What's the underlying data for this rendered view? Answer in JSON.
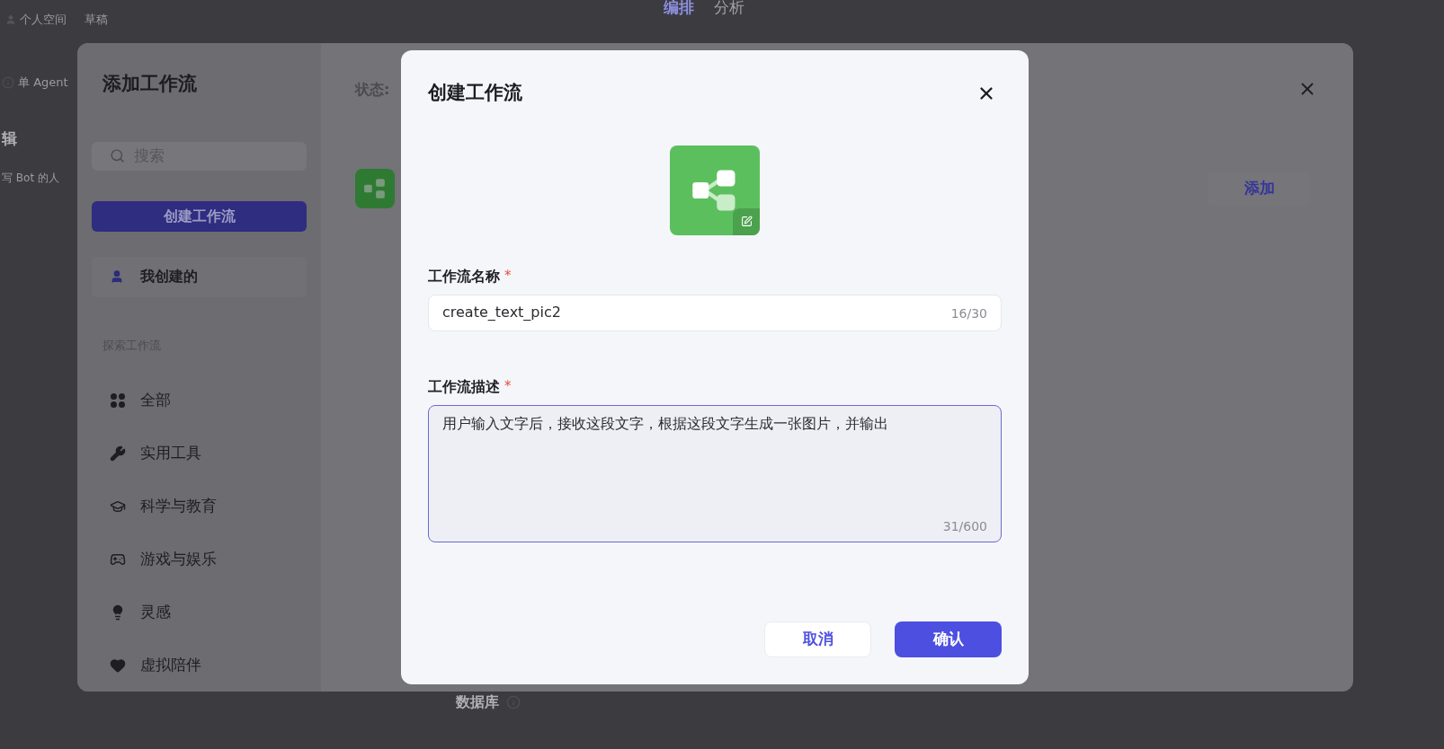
{
  "background_page": {
    "breadcrumbs": [
      {
        "text": "个人空间"
      },
      {
        "text": "草稿"
      }
    ],
    "tabs": [
      {
        "label": "编排",
        "selected": true
      },
      {
        "label": "分析",
        "selected": false
      }
    ],
    "mode": "单 Agent",
    "section_title": "辑",
    "section_hint": "写 Bot 的人",
    "bottom_item": "数据库"
  },
  "add_dialog": {
    "title": "添加工作流",
    "search_placeholder": "搜索",
    "create_button": "创建工作流",
    "my_item": {
      "label": "我创建的",
      "selected": true
    },
    "explore_header": "探索工作流",
    "categories": [
      {
        "kind": "all",
        "label": "全部"
      },
      {
        "kind": "tools",
        "label": "实用工具"
      },
      {
        "kind": "education",
        "label": "科学与教育"
      },
      {
        "kind": "games",
        "label": "游戏与娱乐"
      },
      {
        "kind": "inspiration",
        "label": "灵感"
      },
      {
        "kind": "companion",
        "label": "虚拟陪伴"
      }
    ],
    "status_label": "状态:",
    "add_button": "添加"
  },
  "create_dialog": {
    "title": "创建工作流",
    "name_field": {
      "label": "工作流名称",
      "required_mark": "*",
      "value": "create_text_pic2",
      "counter": "16/30",
      "focused": false
    },
    "description_field": {
      "label": "工作流描述",
      "required_mark": "*",
      "value": "用户输入文字后，接收这段文字，根据这段文字生成一张图片，并输出",
      "counter": "31/600",
      "focused": true
    },
    "buttons": [
      {
        "kind": "secondary",
        "label": "取消"
      },
      {
        "kind": "primary",
        "label": "确认"
      }
    ]
  }
}
